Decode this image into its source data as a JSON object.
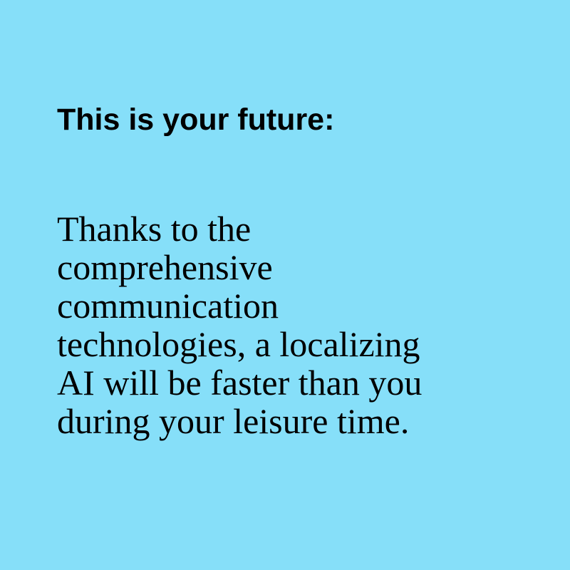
{
  "colors": {
    "background": "#86DFF9",
    "text": "#000000"
  },
  "heading": "This is your future:",
  "body_lines": [
    "Thanks to the",
    "comprehensive",
    "communication",
    "technologies, a localizing",
    "AI will be faster than you",
    "during your leisure time."
  ]
}
